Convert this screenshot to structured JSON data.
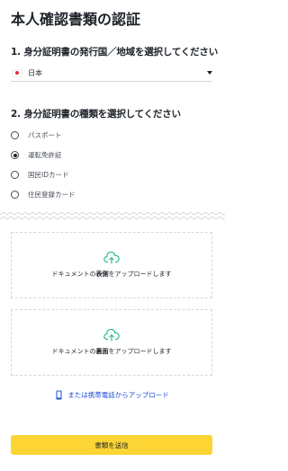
{
  "page": {
    "title": "本人確認書類の認証"
  },
  "issuing_country": {
    "heading": "1. 身分証明書の発行国／地域を選択してください",
    "selected": "日本",
    "flag_icon": "japan-flag-icon"
  },
  "document_type": {
    "heading": "2. 身分証明書の種類を選択してください",
    "options": [
      {
        "label": "パスポート",
        "checked": false
      },
      {
        "label": "運転免許証",
        "checked": true
      },
      {
        "label": "国民IDカード",
        "checked": false
      },
      {
        "label": "住民登録カード",
        "checked": false
      }
    ]
  },
  "upload": {
    "front": {
      "prefix": "ドキュメントの",
      "emphasis": "表側",
      "suffix": "をアップロードします"
    },
    "back": {
      "prefix": "ドキュメントの",
      "emphasis": "裏面",
      "suffix": "をアップロードします"
    },
    "icon": "cloud-upload-icon",
    "icon_color": "#2ebd85"
  },
  "mobile_upload": {
    "label": "または携帯電話からアップロード",
    "icon": "mobile-phone-icon",
    "color": "#1d4ed8"
  },
  "submit": {
    "label": "書類を送信",
    "color": "#fcd535"
  }
}
